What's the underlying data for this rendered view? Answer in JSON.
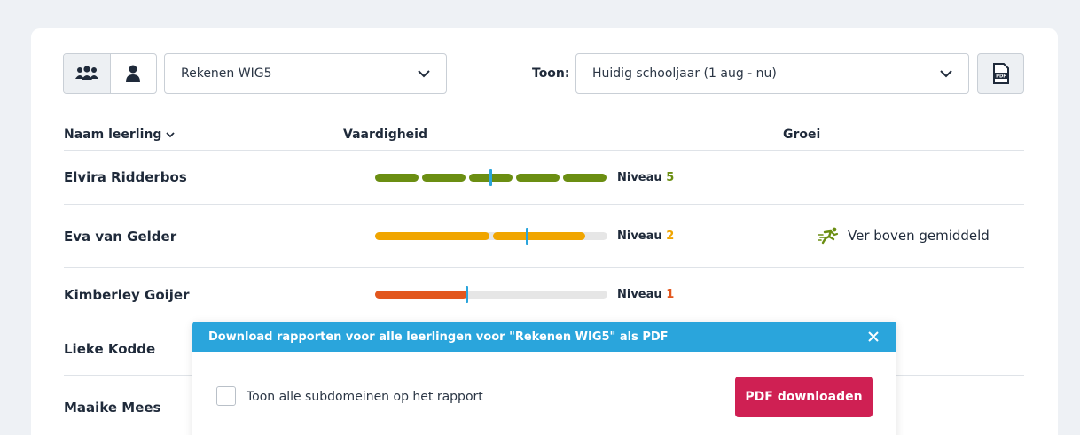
{
  "toolbar": {
    "view_group_icon": "group-icon",
    "view_single_icon": "person-icon",
    "subject_select": {
      "value": "Rekenen WIG5"
    },
    "period_label": "Toon:",
    "period_select": {
      "value": "Huidig schooljaar (1 aug - nu)"
    },
    "pdf_icon": "pdf-file-icon"
  },
  "table": {
    "headers": {
      "name": "Naam leerling",
      "skill": "Vaardigheid",
      "growth": "Groei"
    },
    "rows": [
      {
        "name": "Elvira Ridderbos",
        "niveau_label": "Niveau",
        "niveau": "5",
        "growth": ""
      },
      {
        "name": "Eva van Gelder",
        "niveau_label": "Niveau",
        "niveau": "2",
        "growth": "Ver boven gemiddeld",
        "growth_icon": "runner-icon"
      },
      {
        "name": "Kimberley Goijer",
        "niveau_label": "Niveau",
        "niveau": "1",
        "growth": ""
      },
      {
        "name": "Lieke Kodde"
      },
      {
        "name": "Maaike Mees"
      }
    ]
  },
  "modal": {
    "title": "Download rapporten voor alle leerlingen voor \"Rekenen WIG5\" als PDF",
    "checkbox_label": "Toon alle subdomeinen op het rapport",
    "download_button": "PDF downloaden"
  },
  "colors": {
    "level5": "#6b8e12",
    "level2": "#f0a500",
    "level1": "#e2571e",
    "marker": "#2aa5dc",
    "modal_header": "#2aa5dc",
    "primary_button": "#cf2053"
  }
}
